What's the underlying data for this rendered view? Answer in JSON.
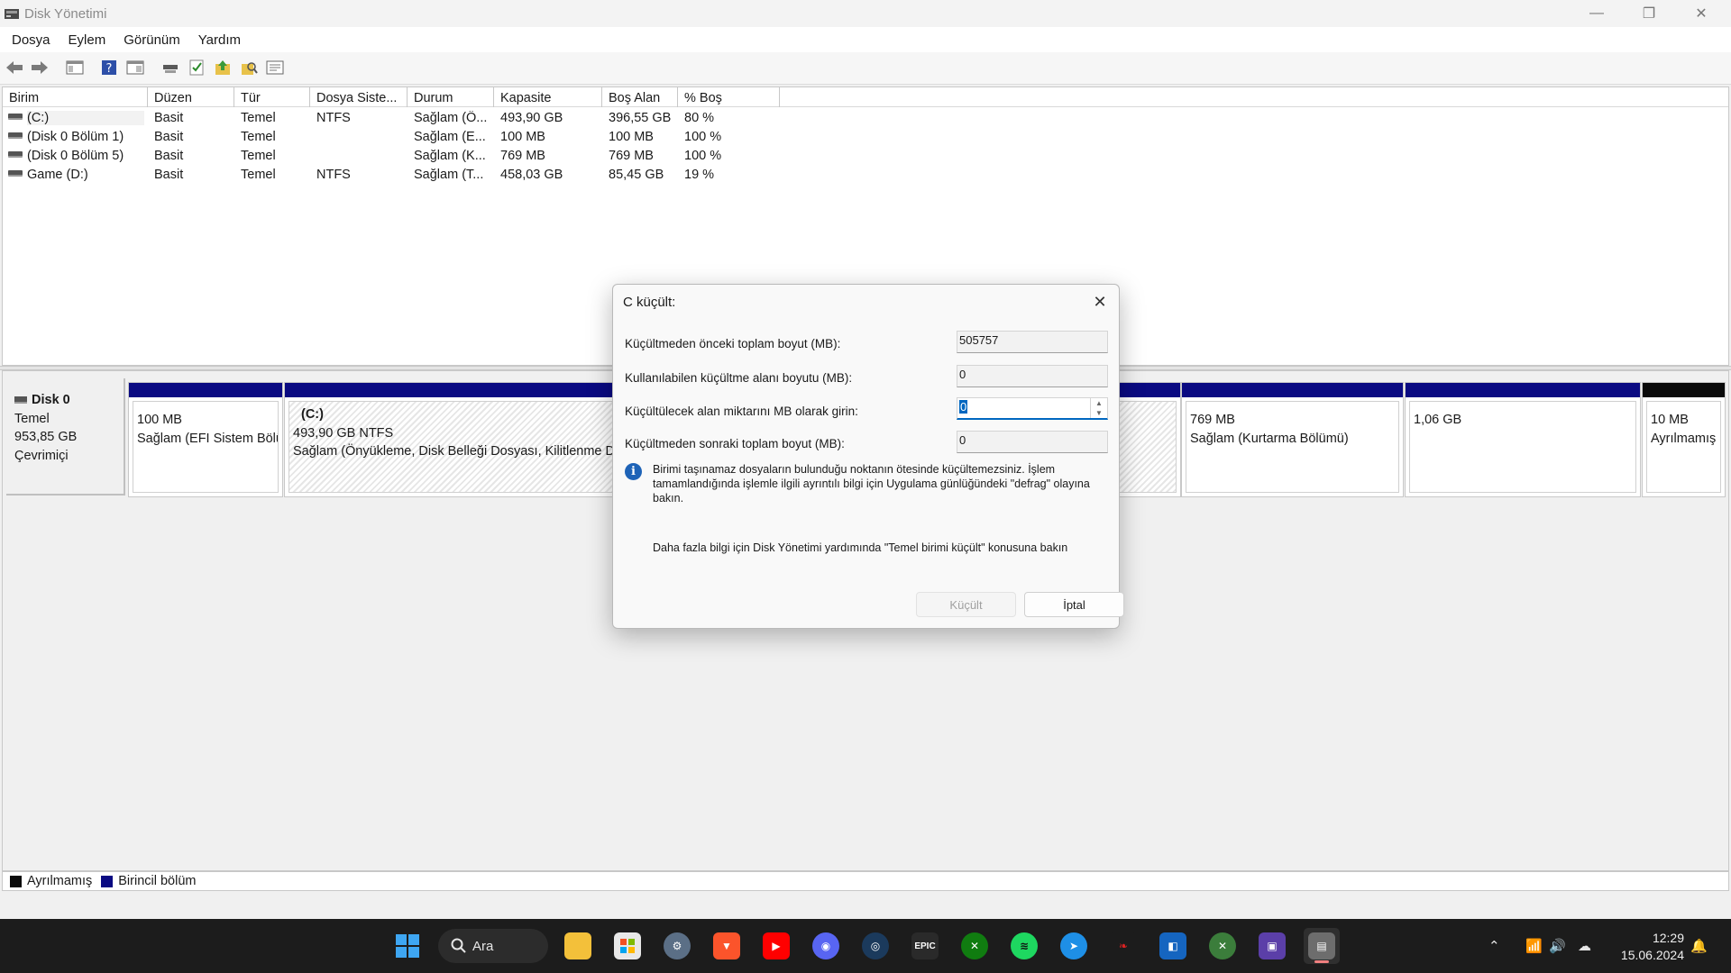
{
  "window": {
    "title": "Disk Yönetimi"
  },
  "menu": [
    "Dosya",
    "Eylem",
    "Görünüm",
    "Yardım"
  ],
  "toolbar": {
    "icons": [
      "back-icon",
      "forward-icon",
      "console-tree-icon",
      "help-icon",
      "properties-view-icon",
      "connect-icon",
      "checklist-icon",
      "folder-up-icon",
      "search-icon",
      "settings-icon"
    ]
  },
  "volumes": {
    "columns": [
      "Birim",
      "Düzen",
      "Tür",
      "Dosya Siste...",
      "Durum",
      "Kapasite",
      "Boş Alan",
      "% Boş"
    ],
    "rows": [
      [
        "(C:)",
        "Basit",
        "Temel",
        "NTFS",
        "Sağlam (Ö...",
        "493,90 GB",
        "396,55 GB",
        "80 %"
      ],
      [
        "(Disk 0 Bölüm 1)",
        "Basit",
        "Temel",
        "",
        "Sağlam (E...",
        "100 MB",
        "100 MB",
        "100 %"
      ],
      [
        "(Disk 0 Bölüm 5)",
        "Basit",
        "Temel",
        "",
        "Sağlam (K...",
        "769 MB",
        "769 MB",
        "100 %"
      ],
      [
        "Game (D:)",
        "Basit",
        "Temel",
        "NTFS",
        "Sağlam (T...",
        "458,03 GB",
        "85,45 GB",
        "19 %"
      ]
    ]
  },
  "disk": {
    "name": "Disk 0",
    "type": "Temel",
    "size": "953,85 GB",
    "status": "Çevrimiçi",
    "partitions": [
      {
        "label": "",
        "size": "100 MB",
        "status": "Sağlam (EFI Sistem Bölü"
      },
      {
        "label": "(C:)",
        "size": "493,90 GB NTFS",
        "status": "Sağlam (Önyükleme, Disk Belleği Dosyası, Kilitlenme D"
      },
      {
        "label": "",
        "size": "769 MB",
        "status": "Sağlam (Kurtarma Bölümü)"
      },
      {
        "label": "",
        "size": "1,06 GB",
        "status": ""
      },
      {
        "label": "",
        "size": "10 MB",
        "status": "Ayrılmamış"
      }
    ]
  },
  "legend": [
    {
      "label": "Ayrılmamış",
      "color": "#0a0a0a"
    },
    {
      "label": "Birincil bölüm",
      "color": "#0a0a82"
    }
  ],
  "dialog": {
    "title": "C küçült:",
    "fields": [
      {
        "label": "Küçültmeden önceki toplam boyut (MB):",
        "value": "505757"
      },
      {
        "label": "Kullanılabilen küçültme alanı boyutu (MB):",
        "value": "0"
      },
      {
        "label": "Küçültülecek alan miktarını MB olarak girin:",
        "value": "0"
      },
      {
        "label": "Küçültmeden sonraki toplam boyut (MB):",
        "value": "0"
      }
    ],
    "info": "Birimi taşınamaz dosyaların bulunduğu noktanın ötesinde küçültemezsiniz. İşlem tamamlandığında işlemle ilgili ayrıntılı bilgi için Uygulama günlüğündeki \"defrag\" olayına bakın.",
    "help": "Daha fazla bilgi için Disk Yönetimi yardımında \"Temel birimi küçült\" konusuna bakın",
    "shrink_button": "Küçült",
    "cancel_button": "İptal"
  },
  "taskbar": {
    "search_label": "Ara",
    "time": "12:29",
    "date": "15.06.2024",
    "apps": [
      "start-icon",
      "file-explorer-icon",
      "microsoft-store-icon",
      "settings-icon",
      "brave-icon",
      "youtube-icon",
      "discord-icon",
      "steam-icon",
      "epic-games-icon",
      "xbox-icon",
      "spotify-icon",
      "browser-icon",
      "redragon-icon",
      "app-icon",
      "xbox-game-bar-icon",
      "cpu-icon",
      "disk-management-icon"
    ]
  }
}
